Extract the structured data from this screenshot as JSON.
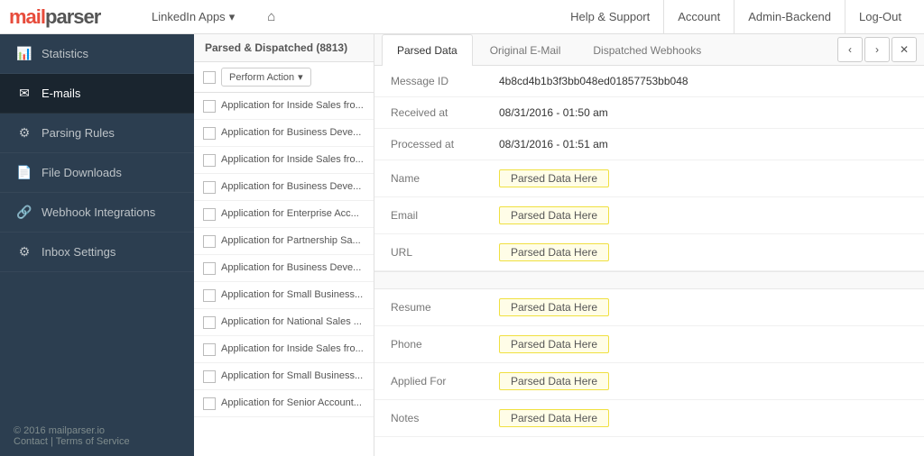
{
  "logo": {
    "mail": "ma",
    "parser": "ilparser",
    "full": "mailparser"
  },
  "topnav": {
    "app_label": "LinkedIn Apps",
    "home_icon": "⌂",
    "dropdown_icon": "▾",
    "links": [
      {
        "label": "Help & Support"
      },
      {
        "label": "Account"
      },
      {
        "label": "Admin-Backend"
      },
      {
        "label": "Log-Out"
      }
    ]
  },
  "sidebar": {
    "items": [
      {
        "label": "Statistics",
        "icon": "📊"
      },
      {
        "label": "E-mails",
        "icon": "✉"
      },
      {
        "label": "Parsing Rules",
        "icon": "🔧"
      },
      {
        "label": "File Downloads",
        "icon": "📄"
      },
      {
        "label": "Webhook Integrations",
        "icon": "🔗"
      },
      {
        "label": "Inbox Settings",
        "icon": "⚙"
      }
    ],
    "footer_year": "© 2016 mailparser.io",
    "footer_contact": "Contact",
    "footer_separator": " | ",
    "footer_terms": "Terms of Service"
  },
  "email_list": {
    "header": "Parsed & Dispatched (8813)",
    "perform_action": "Perform Action",
    "dropdown_icon": "▾",
    "emails": [
      {
        "text": "Application for Inside Sales fro..."
      },
      {
        "text": "Application for Business Deve..."
      },
      {
        "text": "Application for Inside Sales fro..."
      },
      {
        "text": "Application for Business Deve..."
      },
      {
        "text": "Application for Enterprise Acc..."
      },
      {
        "text": "Application for Partnership Sa..."
      },
      {
        "text": "Application for Business Deve..."
      },
      {
        "text": "Application for Small Business..."
      },
      {
        "text": "Application for National Sales ..."
      },
      {
        "text": "Application for Inside Sales fro..."
      },
      {
        "text": "Application for Small Business..."
      },
      {
        "text": "Application for Senior Account..."
      }
    ]
  },
  "detail": {
    "tabs": [
      {
        "label": "Parsed Data",
        "active": true
      },
      {
        "label": "Original E-Mail",
        "active": false
      },
      {
        "label": "Dispatched Webhooks",
        "active": false
      }
    ],
    "nav": {
      "prev": "‹",
      "next": "›",
      "close": "✕"
    },
    "fields": [
      {
        "key": "Message ID",
        "value": "4b8cd4b1b3f3bb048ed01857753bb048",
        "type": "text"
      },
      {
        "key": "Received at",
        "value": "08/31/2016 - 01:50 am",
        "type": "text"
      },
      {
        "key": "Processed at",
        "value": "08/31/2016 - 01:51 am",
        "type": "text"
      },
      {
        "key": "Name",
        "value": "Parsed Data Here",
        "type": "badge"
      },
      {
        "key": "Email",
        "value": "Parsed Data Here",
        "type": "badge"
      },
      {
        "key": "URL",
        "value": "Parsed Data Here",
        "type": "badge"
      }
    ],
    "fields2": [
      {
        "key": "Resume",
        "value": "Parsed Data Here",
        "type": "badge"
      },
      {
        "key": "Phone",
        "value": "Parsed Data Here",
        "type": "badge"
      },
      {
        "key": "Applied For",
        "value": "Parsed Data Here",
        "type": "badge"
      },
      {
        "key": "Notes",
        "value": "Parsed Data Here",
        "type": "badge"
      }
    ]
  }
}
